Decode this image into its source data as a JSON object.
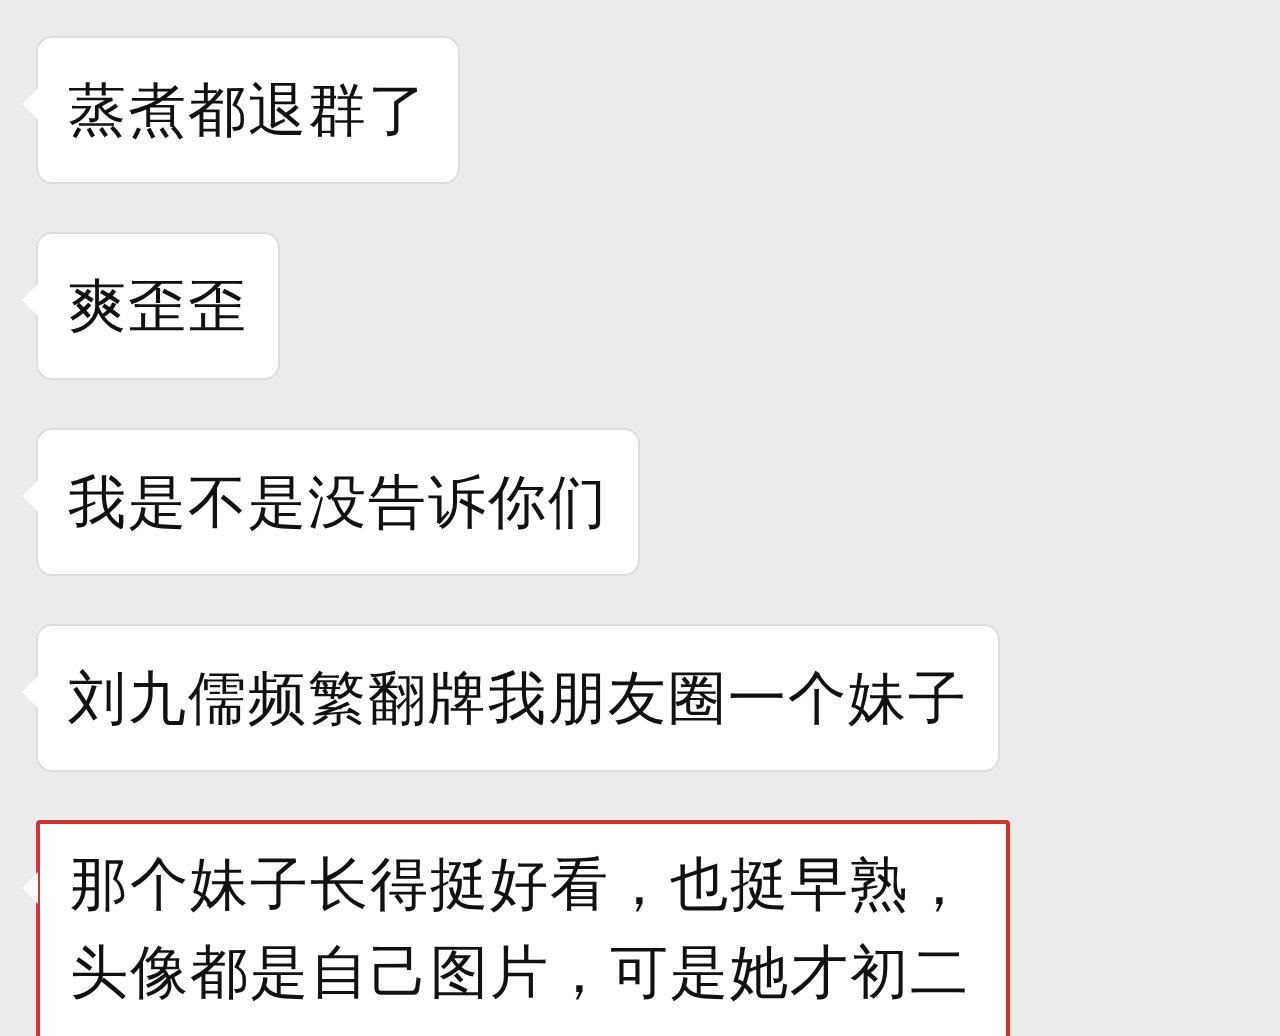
{
  "messages": [
    {
      "lines": [
        "蒸煮都退群了"
      ],
      "highlighted": false
    },
    {
      "lines": [
        "爽歪歪"
      ],
      "highlighted": false
    },
    {
      "lines": [
        "我是不是没告诉你们"
      ],
      "highlighted": false
    },
    {
      "lines": [
        "刘九儒频繁翻牌我朋友圈一个妹子"
      ],
      "highlighted": false
    },
    {
      "lines": [
        "那个妹子长得挺好看，也挺早熟，",
        "头像都是自己图片，可是她才初二"
      ],
      "highlighted": true
    }
  ]
}
